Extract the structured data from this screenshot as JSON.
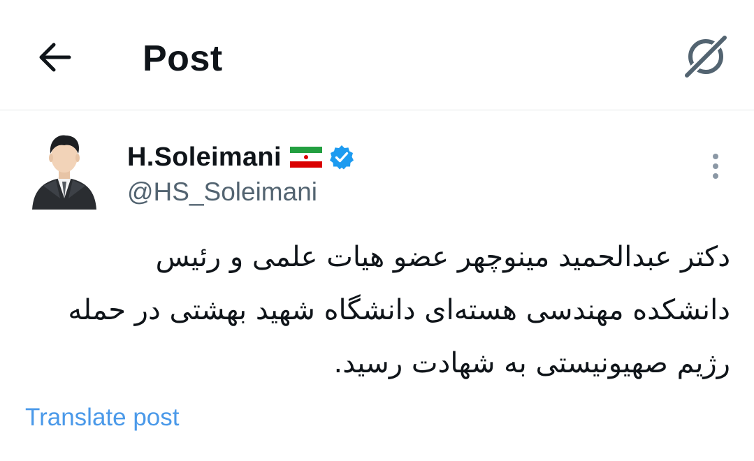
{
  "header": {
    "title": "Post",
    "back_icon": "arrow-left-icon",
    "grok_icon": "grok-icon"
  },
  "author": {
    "display_name": "H.Soleimani",
    "handle": "@HS_Soleimani",
    "flag_icon": "iran-flag-icon",
    "verified_icon": "verified-badge-icon",
    "verified_color": "#1d9bf0"
  },
  "post": {
    "text_lines": [
      "دکتر عبدالحمید مینوچهر عضو هیات علمی و رئیس",
      "دانشکده مهندسی هسته‌ای دانشگاه شهید بهشتی در حمله",
      "رژیم صهیونیستی به شهادت رسید."
    ],
    "translate_label": "Translate post",
    "more_icon": "more-vertical-icon"
  },
  "colors": {
    "text_primary": "#0f1419",
    "text_secondary": "#536471",
    "link": "#4a99e9",
    "divider": "#e3e6e8"
  }
}
